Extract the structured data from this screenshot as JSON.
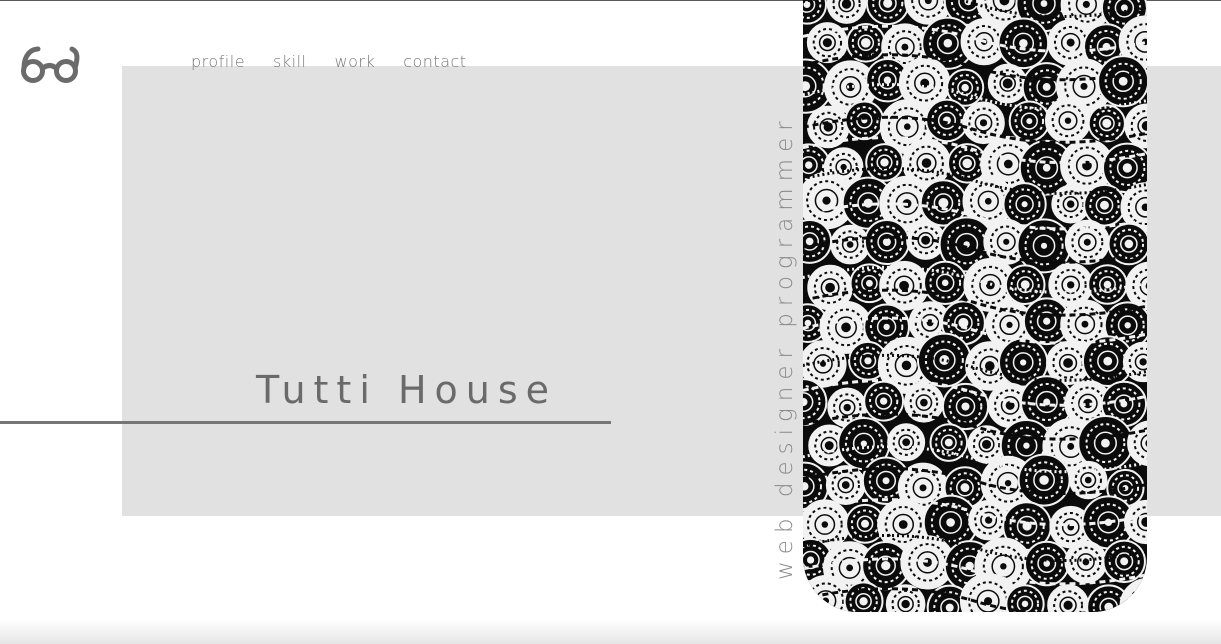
{
  "nav": {
    "items": [
      {
        "label": "profile"
      },
      {
        "label": "skill"
      },
      {
        "label": "work"
      },
      {
        "label": "contact"
      }
    ]
  },
  "hero": {
    "title": "Tutti House",
    "roles": "web designer   programmer"
  },
  "icons": {
    "logo": "glasses-icon"
  },
  "colors": {
    "background": "#ffffff",
    "hero_band": "#e1e1e1",
    "text": "#777777",
    "pattern_dark": "#0b0b0b",
    "pattern_light": "#f2f2f2"
  }
}
